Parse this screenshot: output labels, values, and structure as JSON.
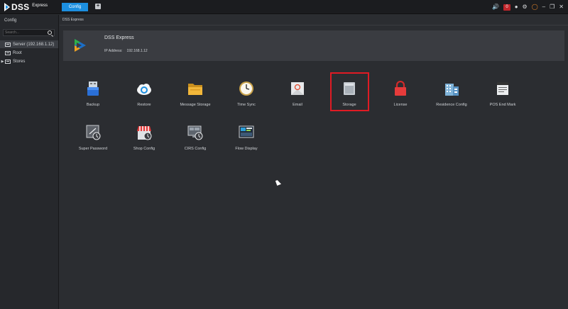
{
  "app": {
    "logo_text": "DSS",
    "logo_suffix": "Express"
  },
  "topbar": {
    "tab_label": "Config",
    "add_tab_symbol": "+",
    "alarm_count": "0",
    "icons": [
      "speaker-icon",
      "user-icon",
      "gear-icon",
      "hardware-icon",
      "minimize-icon",
      "restore-icon",
      "close-icon"
    ],
    "accent_color": "#1c8fe0",
    "alert_color": "#c0262b"
  },
  "sidebar": {
    "title": "Config",
    "search_placeholder": "Search...",
    "items": [
      {
        "label": "Server (192.168.1.12)",
        "selected": true
      },
      {
        "label": "Root",
        "selected": false
      },
      {
        "label": "Stores",
        "selected": false
      }
    ]
  },
  "breadcrumb": "DSS Express",
  "server": {
    "name": "DSS Express",
    "ip_label": "IP Address:",
    "ip_value": "192.168.1.12"
  },
  "tiles": [
    {
      "label": "Backup",
      "icon": "usb-drive-icon"
    },
    {
      "label": "Restore",
      "icon": "cloud-restore-icon"
    },
    {
      "label": "Message Storage",
      "icon": "folder-icon"
    },
    {
      "label": "Time Sync",
      "icon": "clock-icon"
    },
    {
      "label": "Email",
      "icon": "email-icon"
    },
    {
      "label": "Storage",
      "icon": "hard-disk-icon"
    },
    {
      "label": "License",
      "icon": "lock-icon"
    },
    {
      "label": "Residence Config",
      "icon": "building-icon"
    },
    {
      "label": "POS End Mark",
      "icon": "receipt-icon"
    },
    {
      "label": "Super Password",
      "icon": "password-icon"
    },
    {
      "label": "Shop Config",
      "icon": "shop-icon"
    },
    {
      "label": "CIRS Config",
      "icon": "cirs-monitor-icon"
    },
    {
      "label": "Flow Display",
      "icon": "flow-display-icon"
    }
  ],
  "highlight_color": "#e01b24"
}
